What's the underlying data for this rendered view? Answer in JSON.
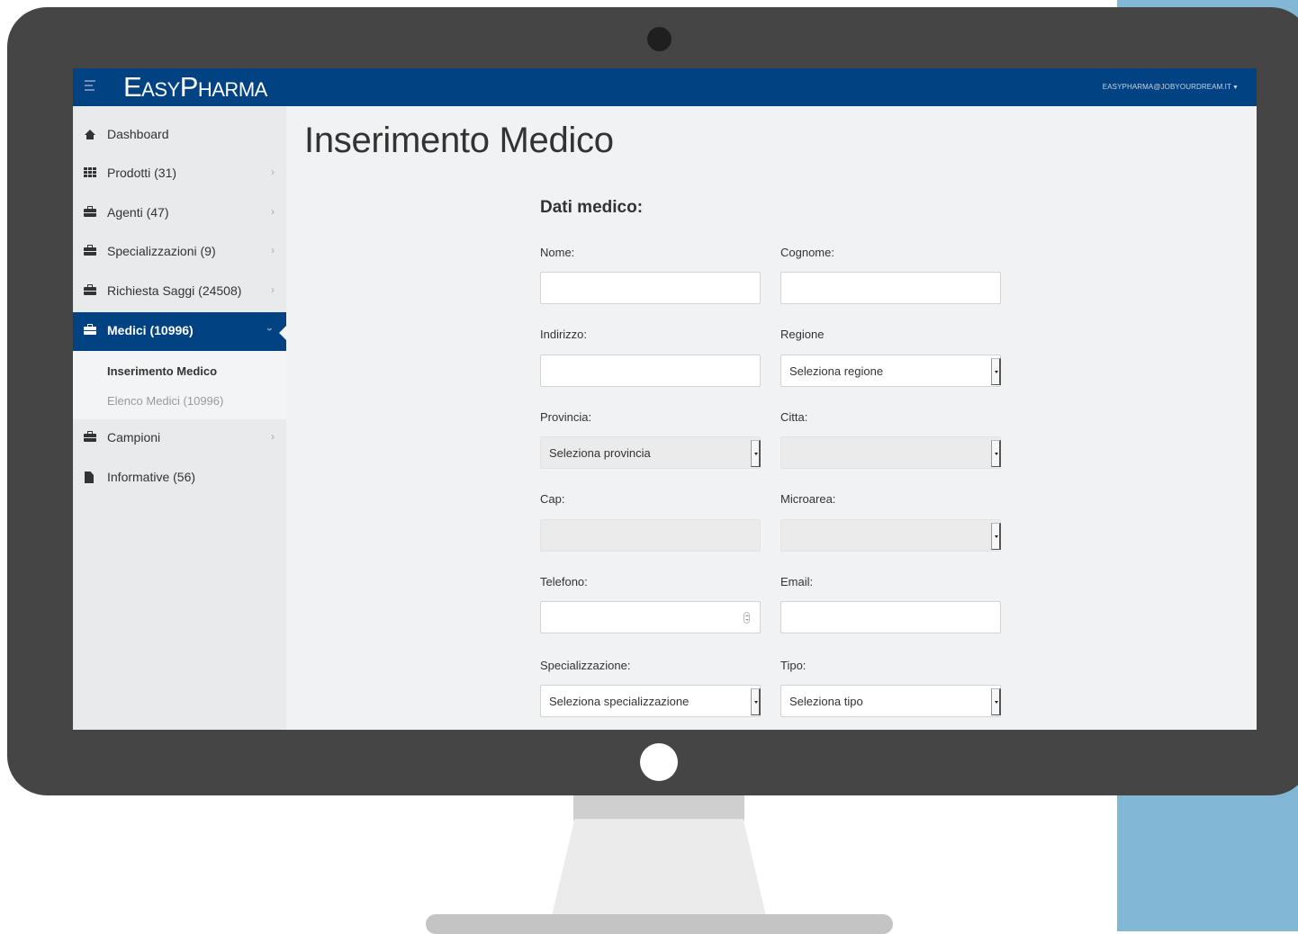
{
  "app": {
    "brand": "EasyPharma",
    "user_menu": "easypharma@jobyourdream.it"
  },
  "sidebar": {
    "items": [
      {
        "label": "Dashboard",
        "icon": "home-icon"
      },
      {
        "label": "Prodotti (31)",
        "icon": "grid-icon"
      },
      {
        "label": "Agenti (47)",
        "icon": "briefcase-icon"
      },
      {
        "label": "Specializzazioni (9)",
        "icon": "briefcase-icon"
      },
      {
        "label": "Richiesta Saggi (24508)",
        "icon": "briefcase-icon"
      },
      {
        "label": "Medici (10996)",
        "icon": "briefcase-icon"
      },
      {
        "label": "Campioni",
        "icon": "briefcase-icon"
      },
      {
        "label": "Informative (56)",
        "icon": "file-icon"
      }
    ],
    "submenu": [
      {
        "label": "Inserimento Medico"
      },
      {
        "label": "Elenco Medici (10996)"
      }
    ]
  },
  "main": {
    "title": "Inserimento Medico",
    "section": "Dati medico:",
    "fields": {
      "nome": {
        "label": "Nome:",
        "value": ""
      },
      "cognome": {
        "label": "Cognome:",
        "value": ""
      },
      "indirizzo": {
        "label": "Indirizzo:",
        "value": ""
      },
      "regione": {
        "label": "Regione",
        "value": "Seleziona regione"
      },
      "provincia": {
        "label": "Provincia:",
        "value": "Seleziona provincia"
      },
      "citta": {
        "label": "Citta:",
        "value": ""
      },
      "cap": {
        "label": "Cap:",
        "value": ""
      },
      "microarea": {
        "label": "Microarea:",
        "value": ""
      },
      "telefono": {
        "label": "Telefono:",
        "value": ""
      },
      "email": {
        "label": "Email:",
        "value": ""
      },
      "specializzazione": {
        "label": "Specializzazione:",
        "value": "Seleziona specializzazione"
      },
      "tipo": {
        "label": "Tipo:",
        "value": "Seleziona tipo"
      }
    }
  },
  "colors": {
    "primary": "#014382",
    "sidebar_bg": "#e9eaec",
    "accent_bg": "#82b8d6"
  }
}
